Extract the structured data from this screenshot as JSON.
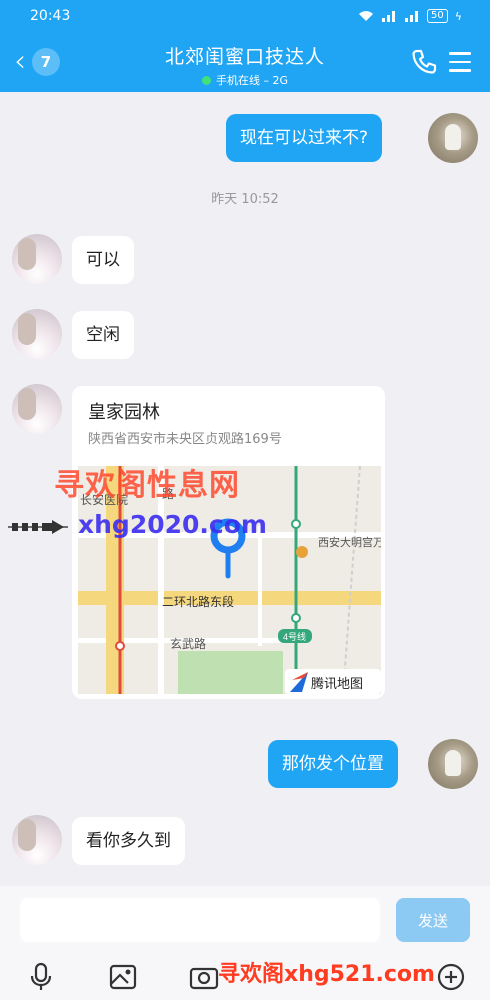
{
  "status_bar": {
    "time": "20:43",
    "battery": "50"
  },
  "header": {
    "back_badge": "7",
    "title": "北郊闺蜜口技达人",
    "subtitle": "手机在线 – 2G"
  },
  "messages": [
    {
      "side": "me",
      "text": "现在可以过来不?"
    },
    {
      "side": "her",
      "text": "可以"
    },
    {
      "side": "her",
      "text": "空闲"
    },
    {
      "side": "me",
      "text": "那你发个位置"
    },
    {
      "side": "her",
      "text": "看你多久到"
    }
  ],
  "timestamp": "昨天 10:52",
  "location_card": {
    "title": "皇家园林",
    "address": "陕西省西安市未央区贞观路169号",
    "map_labels": {
      "hospital": "长安医院",
      "road_fragment": "路",
      "mall": "西安大明宫万达广场",
      "ring_road": "二环北路东段",
      "xuanwu_road": "玄武路",
      "metro_line": "4号线",
      "brand": "腾讯地图"
    }
  },
  "watermarks": {
    "top_cn": "寻欢阁性息网",
    "top_url": "xhg2020.com",
    "bottom": "寻欢阁xhg521.com"
  },
  "input": {
    "send_label": "发送"
  },
  "colors": {
    "accent": "#1fa5f4",
    "send_disabled": "#8cc9f3",
    "background": "#efeff4"
  }
}
